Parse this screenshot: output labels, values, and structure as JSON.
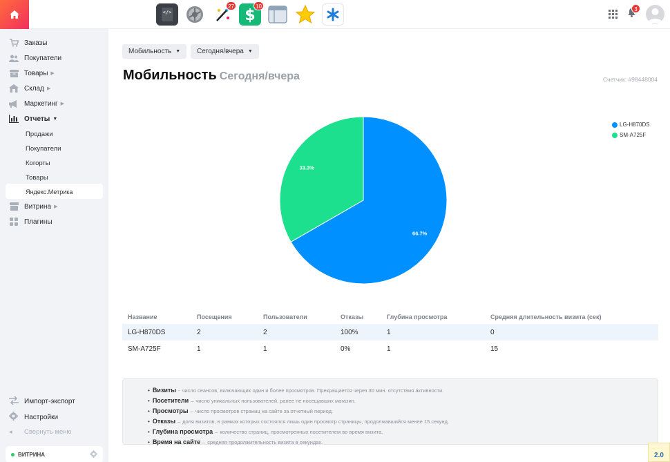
{
  "apps": [
    {
      "name": "code-editor",
      "badge": ""
    },
    {
      "name": "settings-gear",
      "badge": ""
    },
    {
      "name": "magic-wand",
      "badge": "27"
    },
    {
      "name": "cashback",
      "badge": "10"
    },
    {
      "name": "window-layout",
      "badge": ""
    },
    {
      "name": "star",
      "badge": ""
    },
    {
      "name": "asterisk",
      "badge": ""
    }
  ],
  "header": {
    "notifications_badge": "3"
  },
  "sidebar": {
    "items": [
      {
        "label": "Заказы",
        "icon": "cart-icon"
      },
      {
        "label": "Покупатели",
        "icon": "users-icon"
      },
      {
        "label": "Товары",
        "icon": "box-icon"
      },
      {
        "label": "Склад",
        "icon": "warehouse-icon"
      },
      {
        "label": "Маркетинг",
        "icon": "megaphone-icon"
      },
      {
        "label": "Отчеты",
        "icon": "bar-chart-icon"
      },
      {
        "label": "Витрина",
        "icon": "storefront-icon"
      },
      {
        "label": "Плагины",
        "icon": "plugins-icon"
      }
    ],
    "report_subitems": [
      "Продажи",
      "Покупатели",
      "Когорты",
      "Товары",
      "Яндекс.Метрика"
    ],
    "bottom": {
      "import_export": "Импорт-экспорт",
      "settings": "Настройки",
      "collapse": "Свернуть меню",
      "storefront": "ВИТРИНА"
    }
  },
  "main": {
    "filters": {
      "metric": "Мобильность",
      "period": "Сегодня/вчера"
    },
    "title": "Мобильность",
    "subtitle": "Сегодня/вчера",
    "counter": "Счетчик: #98448004"
  },
  "chart_data": {
    "type": "pie",
    "slices": [
      {
        "name": "LG-H870DS",
        "value": 66.7,
        "label": "66.7%",
        "color": "#0090ff"
      },
      {
        "name": "SM-A725F",
        "value": 33.3,
        "label": "33.3%",
        "color": "#1de08e"
      }
    ],
    "legend_position": "top-right"
  },
  "table": {
    "headers": [
      "Название",
      "Посещения",
      "Пользователи",
      "Отказы",
      "Глубина просмотра",
      "Средняя длительность визита (сек)"
    ],
    "rows": [
      [
        "LG-H870DS",
        "2",
        "2",
        "100%",
        "1",
        "0"
      ],
      [
        "SM-A725F",
        "1",
        "1",
        "0%",
        "1",
        "15"
      ]
    ]
  },
  "info": [
    {
      "term": "Визиты",
      "sep": "-",
      "text": "число сеансов, включающих один и более просмотров. Прекращается через 30 мин. отсутствия активности."
    },
    {
      "term": "Посетители",
      "sep": "–",
      "text": "число уникальных пользователей, ранее не посещавших магазин."
    },
    {
      "term": "Просмотры",
      "sep": "–",
      "text": "число просмотров страниц на сайте за отчетный период."
    },
    {
      "term": "Отказы",
      "sep": "–",
      "text": "доля визитов, в рамках которых состоялся лишь один просмотр страницы, продолжавшийся менее 15 секунд."
    },
    {
      "term": "Глубина просмотра",
      "sep": "–",
      "text": "количество страниц, просмотренных посетителем во время визита."
    },
    {
      "term": "Время на сайте",
      "sep": "–",
      "text": "средняя продолжительность визита в секундах."
    }
  ],
  "version": "2.0"
}
